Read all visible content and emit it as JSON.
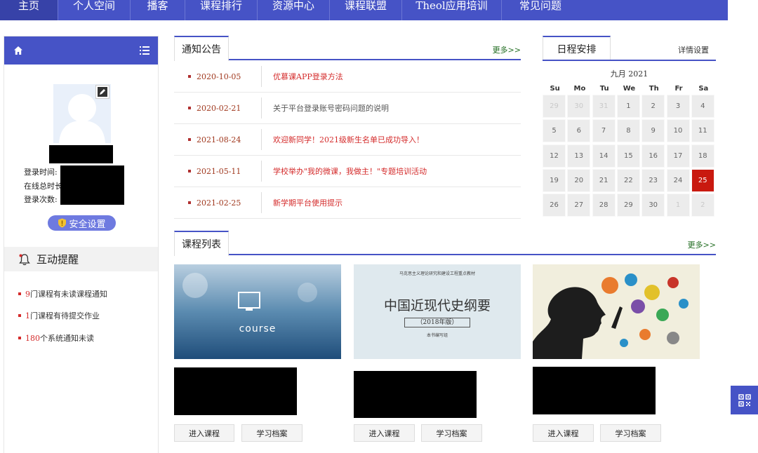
{
  "nav": {
    "items": [
      "主页",
      "个人空间",
      "播客",
      "课程排行",
      "资源中心",
      "课程联盟",
      "Theol应用培训",
      "常见问题"
    ],
    "active_index": 0
  },
  "sidebar": {
    "login_time_label": "登录时间:",
    "online_total_label": "在线总时长",
    "login_count_label": "登录次数:",
    "security_button": "安全设置",
    "interact_title": "互动提醒",
    "reminders": [
      {
        "num": "9",
        "text": "门课程有未读课程通知"
      },
      {
        "num": "1",
        "text": "门课程有待提交作业"
      },
      {
        "num": "180",
        "text": "个系统通知未读"
      }
    ]
  },
  "notice": {
    "title": "通知公告",
    "more": "更多>>",
    "items": [
      {
        "date": "2020-10-05",
        "text": "优慕课APP登录方法",
        "highlight": true
      },
      {
        "date": "2020-02-21",
        "text": "关于平台登录账号密码问题的说明",
        "highlight": false
      },
      {
        "date": "2021-08-24",
        "text": "欢迎新同学！2021级新生名单已成功导入！",
        "highlight": true
      },
      {
        "date": "2021-05-11",
        "text": "学校举办\"我的微课，我做主！\"专题培训活动",
        "highlight": true
      },
      {
        "date": "2021-02-25",
        "text": "新学期平台使用提示",
        "highlight": true
      }
    ]
  },
  "calendar": {
    "title": "日程安排",
    "settings": "详情设置",
    "month_label": "九月 2021",
    "weekdays": [
      "Su",
      "Mo",
      "Tu",
      "We",
      "Th",
      "Fr",
      "Sa"
    ],
    "weeks": [
      [
        "29",
        "30",
        "31",
        "1",
        "2",
        "3",
        "4"
      ],
      [
        "5",
        "6",
        "7",
        "8",
        "9",
        "10",
        "11"
      ],
      [
        "12",
        "13",
        "14",
        "15",
        "16",
        "17",
        "18"
      ],
      [
        "19",
        "20",
        "21",
        "22",
        "23",
        "24",
        "25"
      ],
      [
        "26",
        "27",
        "28",
        "29",
        "30",
        "1",
        "2"
      ]
    ],
    "today": "25",
    "today_color": "#c9190f"
  },
  "courses": {
    "title": "课程列表",
    "more": "更多>>",
    "enter_label": "进入课程",
    "archive_label": "学习档案",
    "items": [
      {
        "image_text": "course"
      },
      {
        "image_text": "中国近现代史纲要",
        "image_edition": "（2018年版）",
        "image_top_text": "马克思主义理论研究和建设工程重点教材",
        "image_bottom_text": "本书编写组"
      },
      {
        "image_text": ""
      }
    ]
  },
  "colors": {
    "primary": "#4653c6",
    "accent_red": "#d42b2b",
    "more_green": "#1f6b1f"
  }
}
